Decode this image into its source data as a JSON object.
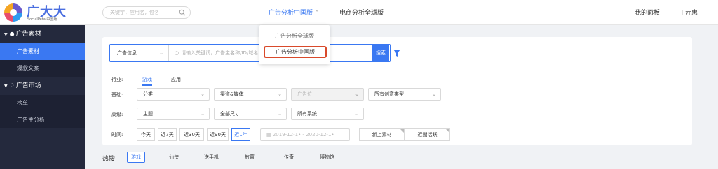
{
  "logo": {
    "title": "广大大",
    "subtitle": "SocialPeta 中国版"
  },
  "search": {
    "placeholder": "关键字，应用名，包名"
  },
  "nav": {
    "cn_label": "广告分析中国版",
    "global_label": "电商分析全球版",
    "chevron": "⌃"
  },
  "header_right": {
    "panel": "我的面板",
    "user": "丁亓惠"
  },
  "dropdown": {
    "items": [
      "广告分析全球版",
      "广告分析中国版"
    ]
  },
  "sidebar": {
    "groups": [
      {
        "label": "广告素材",
        "icon": "bulb-icon",
        "items": [
          "广告素材",
          "爆款文案"
        ]
      },
      {
        "label": "广告市场",
        "icon": "trophy-icon",
        "items": [
          "榜单",
          "广告主分析"
        ]
      }
    ]
  },
  "main": {
    "search_type": "广告信息",
    "search_placeholder": "请输入关键词，广告主名称/ID/域名",
    "search_button": "搜索",
    "industry_label": "行业:",
    "industry_tabs": [
      "游戏",
      "应用"
    ],
    "basic_label": "基础:",
    "basic_selects": [
      "分类",
      "渠道&媒体",
      "广告位",
      "所有创意类型"
    ],
    "advanced_label": "高级:",
    "advanced_selects": [
      "主题",
      "全部尺寸",
      "所有系统"
    ],
    "time_label": "时间:",
    "time_segments": [
      "今天",
      "近7天",
      "近30天",
      "近90天",
      "近1年"
    ],
    "date_range": "2019-12-1• - 2020-12-1•",
    "time_tags": [
      "新上素材",
      "近期活跃"
    ]
  },
  "hot": {
    "label": "热搜:",
    "tags": [
      "游戏",
      "仙侠",
      "送手机",
      "放置",
      "传奇",
      "博物馆"
    ]
  }
}
